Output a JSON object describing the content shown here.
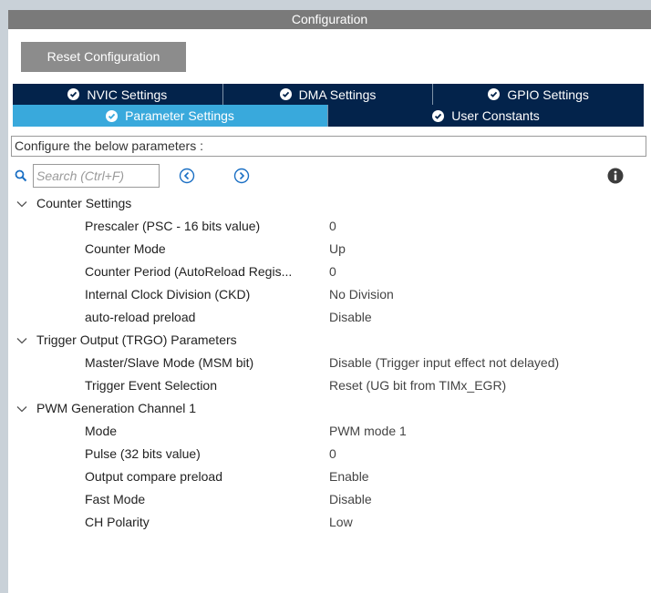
{
  "window": {
    "title": "Configuration"
  },
  "toolbar": {
    "reset_label": "Reset Configuration"
  },
  "tabs_row1": [
    {
      "label": "NVIC Settings",
      "icon": "check-circle-icon"
    },
    {
      "label": "DMA Settings",
      "icon": "check-circle-icon"
    },
    {
      "label": "GPIO Settings",
      "icon": "check-circle-icon"
    }
  ],
  "tabs_row2": [
    {
      "label": "Parameter Settings",
      "icon": "check-circle-icon",
      "active": true
    },
    {
      "label": "User Constants",
      "icon": "check-circle-icon"
    }
  ],
  "description": "Configure the below parameters :",
  "search": {
    "placeholder": "Search (Ctrl+F)"
  },
  "groups": [
    {
      "label": "Counter Settings",
      "params": [
        {
          "name": "Prescaler (PSC - 16 bits value)",
          "value": "0"
        },
        {
          "name": "Counter Mode",
          "value": "Up"
        },
        {
          "name": "Counter Period (AutoReload Regis...",
          "value": "0"
        },
        {
          "name": "Internal Clock Division (CKD)",
          "value": "No Division"
        },
        {
          "name": "auto-reload preload",
          "value": "Disable"
        }
      ]
    },
    {
      "label": "Trigger Output (TRGO) Parameters",
      "params": [
        {
          "name": "Master/Slave Mode (MSM bit)",
          "value": "Disable (Trigger input effect not delayed)"
        },
        {
          "name": "Trigger Event Selection",
          "value": "Reset (UG bit from TIMx_EGR)"
        }
      ]
    },
    {
      "label": "PWM Generation Channel 1",
      "params": [
        {
          "name": "Mode",
          "value": "PWM mode 1"
        },
        {
          "name": "Pulse (32 bits value)",
          "value": "0"
        },
        {
          "name": "Output compare preload",
          "value": "Enable"
        },
        {
          "name": "Fast Mode",
          "value": "Disable"
        },
        {
          "name": "CH Polarity",
          "value": "Low"
        }
      ]
    }
  ],
  "colors": {
    "tab_dark": "#03234b",
    "tab_active": "#39a9dc",
    "accent_blue": "#1a6fc4"
  }
}
